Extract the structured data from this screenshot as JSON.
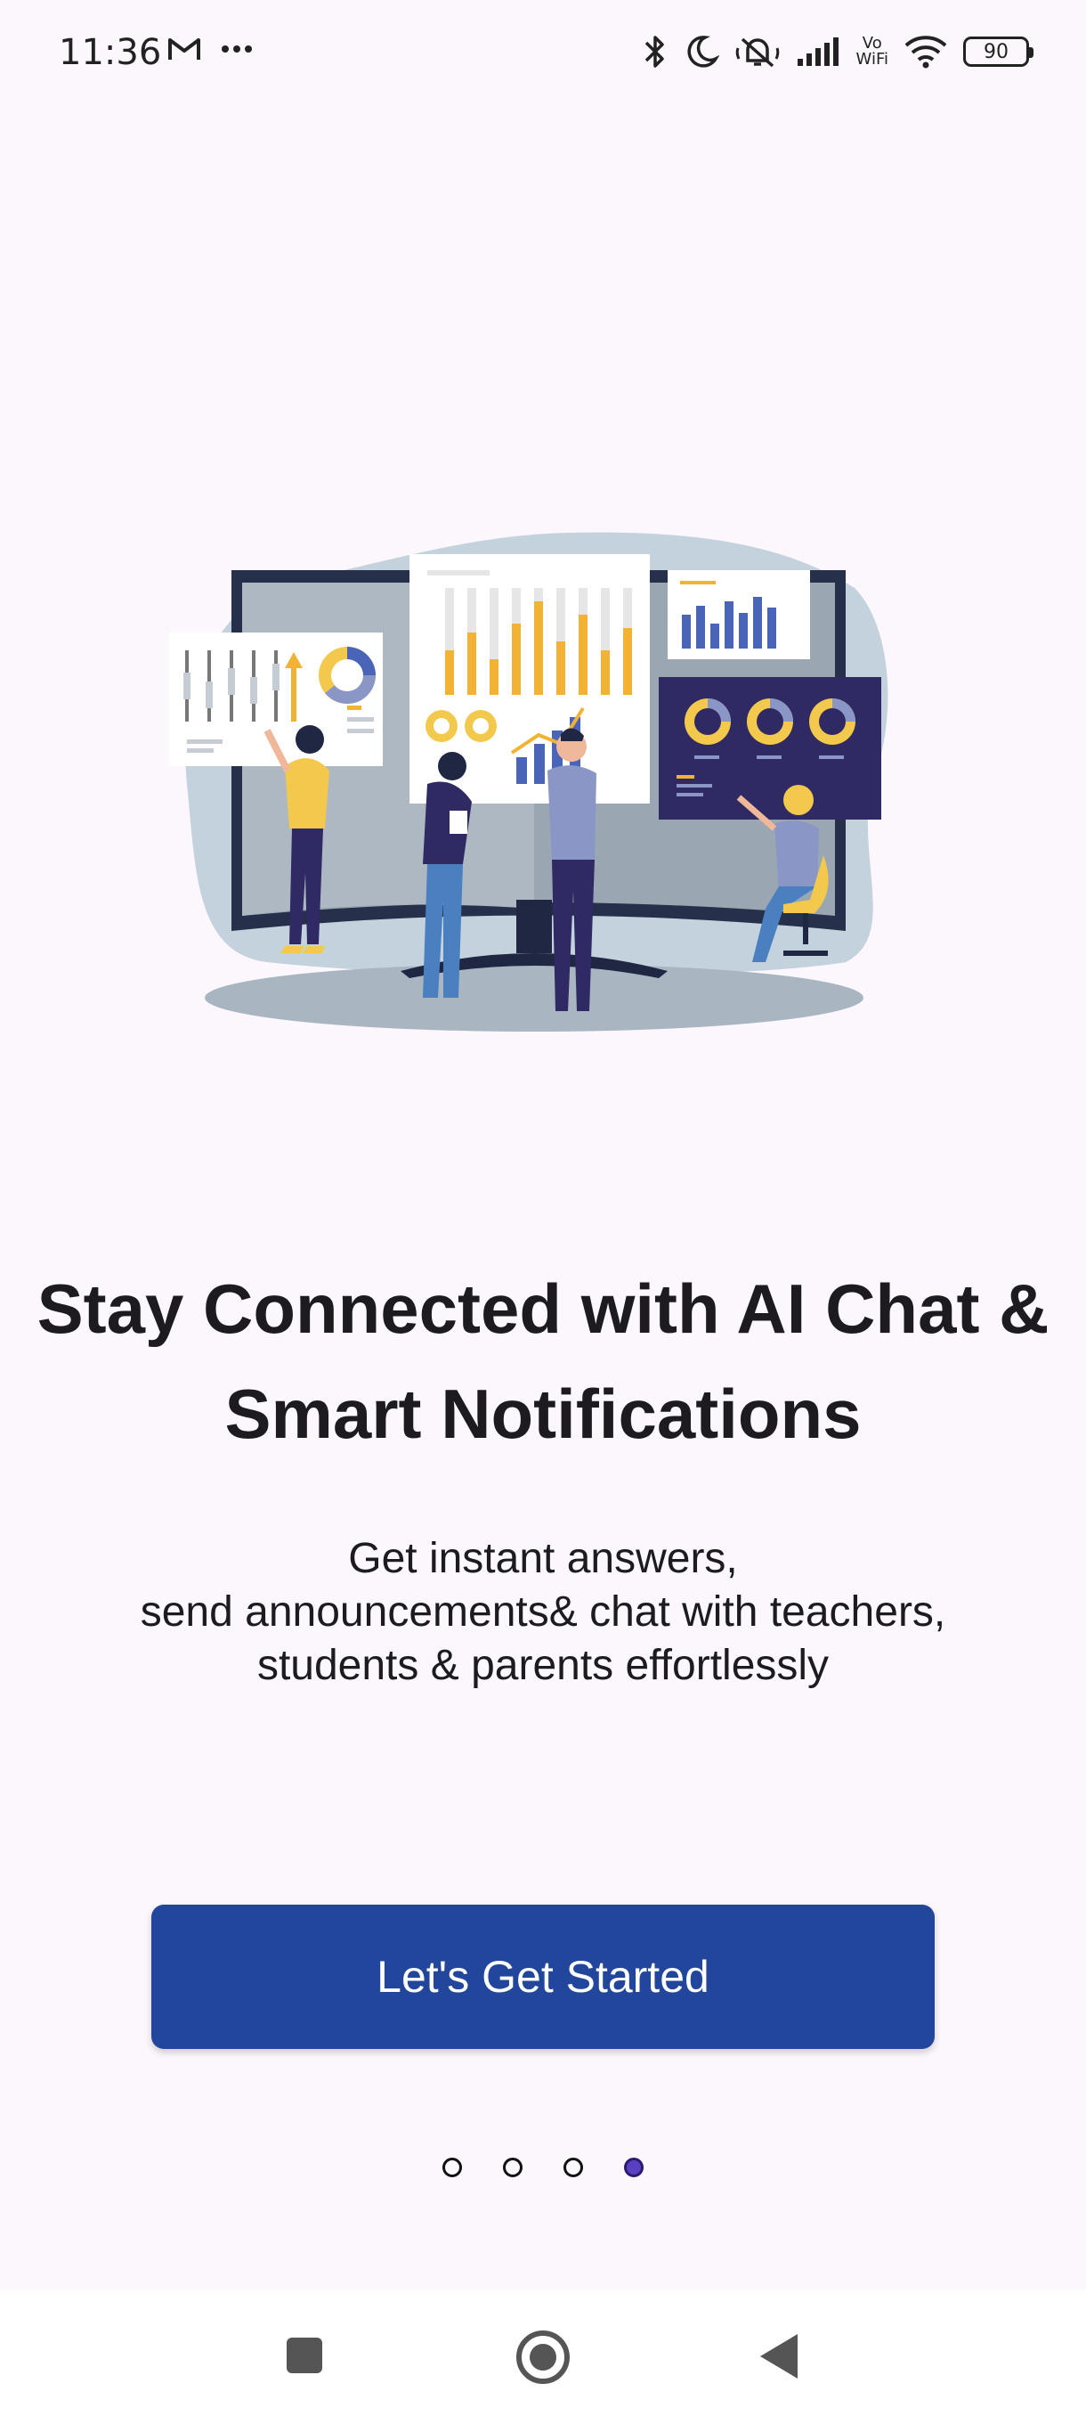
{
  "status_bar": {
    "time": "11:36",
    "left_icons": [
      "gmail-icon",
      "more-dots-icon"
    ],
    "right_icons": [
      "bluetooth-icon",
      "do-not-disturb-moon-icon",
      "silent-bell-icon",
      "signal-icon",
      "vowifi-icon",
      "wifi-icon",
      "battery-icon"
    ],
    "vowifi_top": "Vo",
    "vowifi_bottom": "WiFi",
    "battery": "90"
  },
  "onboarding": {
    "headline": "Stay Connected with AI Chat & Smart Notifications",
    "subtext": "Get instant answers,\nsend announcements& chat with teachers,\nstudents & parents effortlessly",
    "cta_label": "Let's Get Started",
    "page_count": 4,
    "active_page": 4
  },
  "colors": {
    "background": "#fcf7fc",
    "primary": "#21469c",
    "active_dot": "#5a3fc0"
  },
  "nav_bar": {
    "buttons": [
      "recents-square-icon",
      "home-circle-icon",
      "back-triangle-icon"
    ]
  }
}
